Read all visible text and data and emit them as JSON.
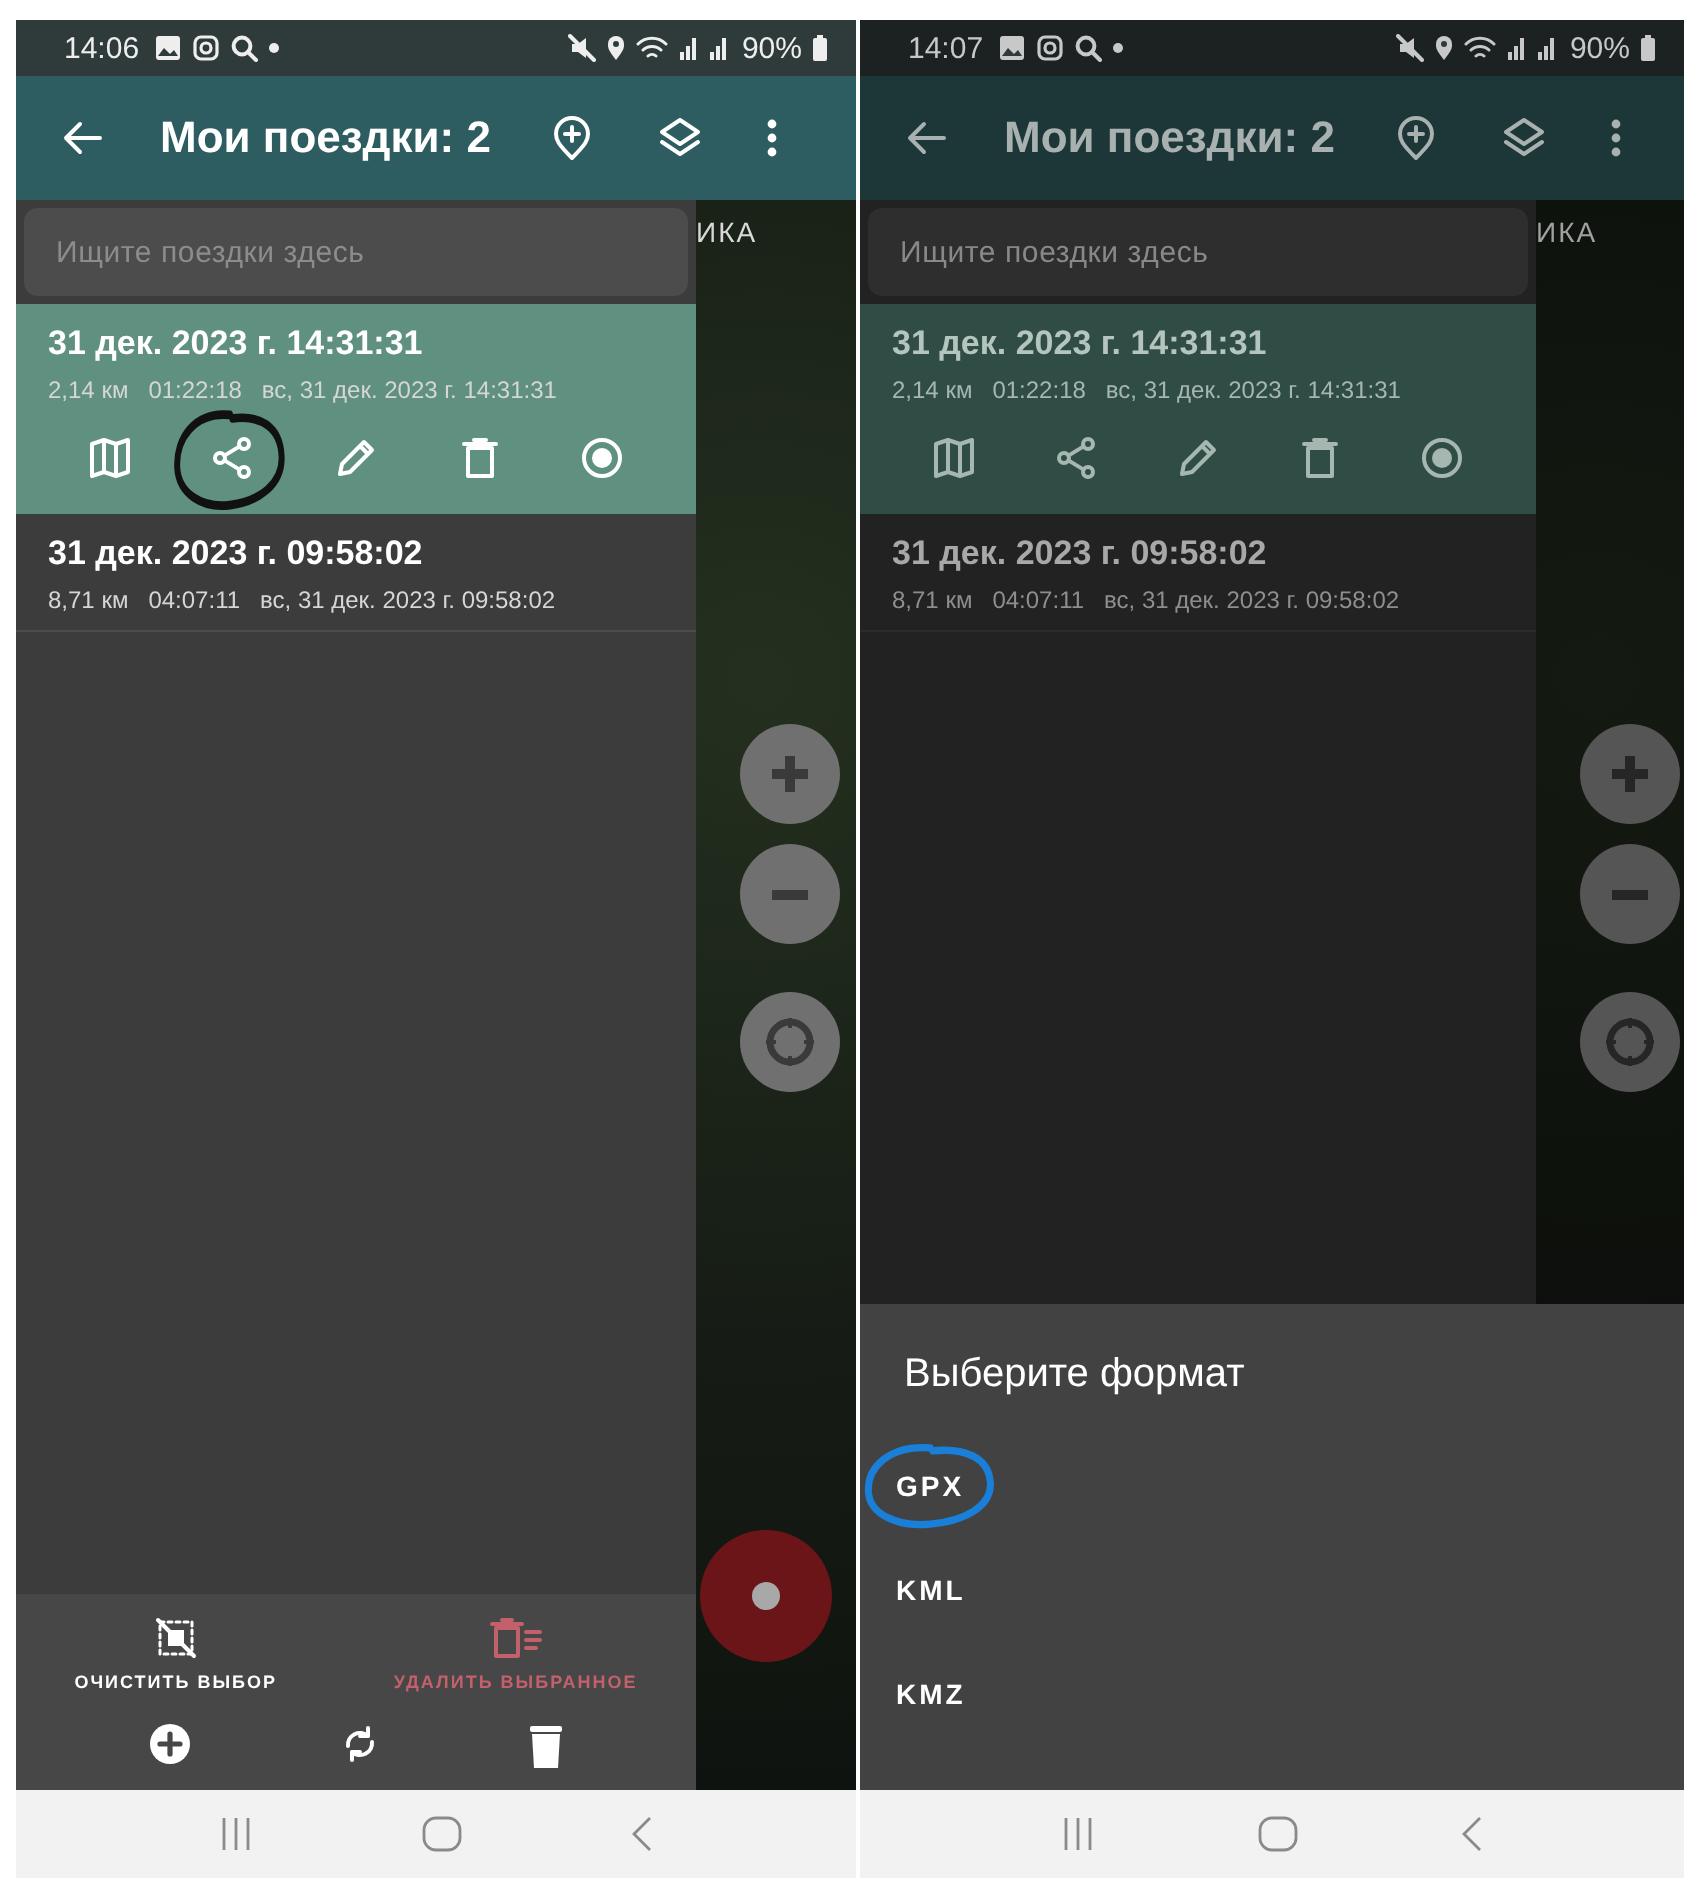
{
  "screens": [
    {
      "dimmed": false,
      "status_bar": {
        "time": "14:06",
        "battery": "90%"
      },
      "app_bar": {
        "title": "Мои поездки: 2"
      },
      "search": {
        "placeholder": "Ищите поездки здесь"
      },
      "map_label": "ИКА",
      "trips": [
        {
          "title": "31 дек. 2023 г. 14:31:31",
          "distance": "2,14 км",
          "duration": "01:22:18",
          "date": "вс, 31 дек. 2023 г. 14:31:31",
          "selected": true,
          "actions": [
            {
              "kind": "map",
              "circled": false
            },
            {
              "kind": "share",
              "circled": true
            },
            {
              "kind": "edit",
              "circled": false
            },
            {
              "kind": "delete",
              "circled": false
            },
            {
              "kind": "record",
              "circled": false
            }
          ]
        },
        {
          "title": "31 дек. 2023 г. 09:58:02",
          "distance": "8,71 км",
          "duration": "04:07:11",
          "date": "вс, 31 дек. 2023 г. 09:58:02",
          "selected": false
        }
      ],
      "bottom_bar": {
        "actions": [
          {
            "kind": "clear",
            "label": "ОЧИСТИТЬ ВЫБОР",
            "color": "#ffffff"
          },
          {
            "kind": "delete-selected",
            "label": "УДАЛИТЬ ВЫБРАННОЕ",
            "color": "#c2606c"
          }
        ],
        "tools": [
          {
            "kind": "add"
          },
          {
            "kind": "sync"
          },
          {
            "kind": "delete"
          }
        ]
      },
      "fab": {
        "kind": "record"
      }
    },
    {
      "dimmed": true,
      "status_bar": {
        "time": "14:07",
        "battery": "90%"
      },
      "app_bar": {
        "title": "Мои поездки: 2"
      },
      "search": {
        "placeholder": "Ищите поездки здесь"
      },
      "map_label": "ИКА",
      "trips": [
        {
          "title": "31 дек. 2023 г. 14:31:31",
          "distance": "2,14 км",
          "duration": "01:22:18",
          "date": "вс, 31 дек. 2023 г. 14:31:31",
          "selected": true,
          "actions": [
            {
              "kind": "map",
              "circled": false
            },
            {
              "kind": "share",
              "circled": false
            },
            {
              "kind": "edit",
              "circled": false
            },
            {
              "kind": "delete",
              "circled": false
            },
            {
              "kind": "record",
              "circled": false
            }
          ]
        },
        {
          "title": "31 дек. 2023 г. 09:58:02",
          "distance": "8,71 км",
          "duration": "04:07:11",
          "date": "вс, 31 дек. 2023 г. 09:58:02",
          "selected": false
        }
      ],
      "sheet": {
        "title": "Выберите формат",
        "options": [
          {
            "label": "GPX",
            "circled": true
          },
          {
            "label": "KML",
            "circled": false
          },
          {
            "label": "KMZ",
            "circled": false
          }
        ]
      }
    }
  ]
}
